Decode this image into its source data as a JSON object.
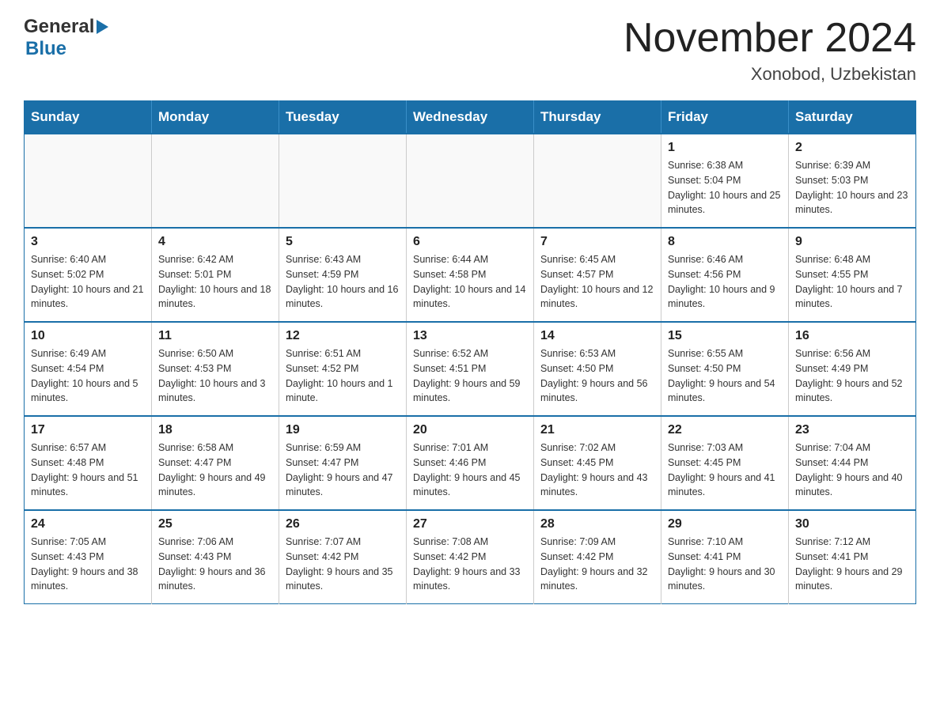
{
  "header": {
    "month_year": "November 2024",
    "location": "Xonobod, Uzbekistan",
    "logo_general": "General",
    "logo_blue": "Blue"
  },
  "days_of_week": [
    "Sunday",
    "Monday",
    "Tuesday",
    "Wednesday",
    "Thursday",
    "Friday",
    "Saturday"
  ],
  "weeks": [
    [
      {
        "day": "",
        "info": ""
      },
      {
        "day": "",
        "info": ""
      },
      {
        "day": "",
        "info": ""
      },
      {
        "day": "",
        "info": ""
      },
      {
        "day": "",
        "info": ""
      },
      {
        "day": "1",
        "info": "Sunrise: 6:38 AM\nSunset: 5:04 PM\nDaylight: 10 hours and 25 minutes."
      },
      {
        "day": "2",
        "info": "Sunrise: 6:39 AM\nSunset: 5:03 PM\nDaylight: 10 hours and 23 minutes."
      }
    ],
    [
      {
        "day": "3",
        "info": "Sunrise: 6:40 AM\nSunset: 5:02 PM\nDaylight: 10 hours and 21 minutes."
      },
      {
        "day": "4",
        "info": "Sunrise: 6:42 AM\nSunset: 5:01 PM\nDaylight: 10 hours and 18 minutes."
      },
      {
        "day": "5",
        "info": "Sunrise: 6:43 AM\nSunset: 4:59 PM\nDaylight: 10 hours and 16 minutes."
      },
      {
        "day": "6",
        "info": "Sunrise: 6:44 AM\nSunset: 4:58 PM\nDaylight: 10 hours and 14 minutes."
      },
      {
        "day": "7",
        "info": "Sunrise: 6:45 AM\nSunset: 4:57 PM\nDaylight: 10 hours and 12 minutes."
      },
      {
        "day": "8",
        "info": "Sunrise: 6:46 AM\nSunset: 4:56 PM\nDaylight: 10 hours and 9 minutes."
      },
      {
        "day": "9",
        "info": "Sunrise: 6:48 AM\nSunset: 4:55 PM\nDaylight: 10 hours and 7 minutes."
      }
    ],
    [
      {
        "day": "10",
        "info": "Sunrise: 6:49 AM\nSunset: 4:54 PM\nDaylight: 10 hours and 5 minutes."
      },
      {
        "day": "11",
        "info": "Sunrise: 6:50 AM\nSunset: 4:53 PM\nDaylight: 10 hours and 3 minutes."
      },
      {
        "day": "12",
        "info": "Sunrise: 6:51 AM\nSunset: 4:52 PM\nDaylight: 10 hours and 1 minute."
      },
      {
        "day": "13",
        "info": "Sunrise: 6:52 AM\nSunset: 4:51 PM\nDaylight: 9 hours and 59 minutes."
      },
      {
        "day": "14",
        "info": "Sunrise: 6:53 AM\nSunset: 4:50 PM\nDaylight: 9 hours and 56 minutes."
      },
      {
        "day": "15",
        "info": "Sunrise: 6:55 AM\nSunset: 4:50 PM\nDaylight: 9 hours and 54 minutes."
      },
      {
        "day": "16",
        "info": "Sunrise: 6:56 AM\nSunset: 4:49 PM\nDaylight: 9 hours and 52 minutes."
      }
    ],
    [
      {
        "day": "17",
        "info": "Sunrise: 6:57 AM\nSunset: 4:48 PM\nDaylight: 9 hours and 51 minutes."
      },
      {
        "day": "18",
        "info": "Sunrise: 6:58 AM\nSunset: 4:47 PM\nDaylight: 9 hours and 49 minutes."
      },
      {
        "day": "19",
        "info": "Sunrise: 6:59 AM\nSunset: 4:47 PM\nDaylight: 9 hours and 47 minutes."
      },
      {
        "day": "20",
        "info": "Sunrise: 7:01 AM\nSunset: 4:46 PM\nDaylight: 9 hours and 45 minutes."
      },
      {
        "day": "21",
        "info": "Sunrise: 7:02 AM\nSunset: 4:45 PM\nDaylight: 9 hours and 43 minutes."
      },
      {
        "day": "22",
        "info": "Sunrise: 7:03 AM\nSunset: 4:45 PM\nDaylight: 9 hours and 41 minutes."
      },
      {
        "day": "23",
        "info": "Sunrise: 7:04 AM\nSunset: 4:44 PM\nDaylight: 9 hours and 40 minutes."
      }
    ],
    [
      {
        "day": "24",
        "info": "Sunrise: 7:05 AM\nSunset: 4:43 PM\nDaylight: 9 hours and 38 minutes."
      },
      {
        "day": "25",
        "info": "Sunrise: 7:06 AM\nSunset: 4:43 PM\nDaylight: 9 hours and 36 minutes."
      },
      {
        "day": "26",
        "info": "Sunrise: 7:07 AM\nSunset: 4:42 PM\nDaylight: 9 hours and 35 minutes."
      },
      {
        "day": "27",
        "info": "Sunrise: 7:08 AM\nSunset: 4:42 PM\nDaylight: 9 hours and 33 minutes."
      },
      {
        "day": "28",
        "info": "Sunrise: 7:09 AM\nSunset: 4:42 PM\nDaylight: 9 hours and 32 minutes."
      },
      {
        "day": "29",
        "info": "Sunrise: 7:10 AM\nSunset: 4:41 PM\nDaylight: 9 hours and 30 minutes."
      },
      {
        "day": "30",
        "info": "Sunrise: 7:12 AM\nSunset: 4:41 PM\nDaylight: 9 hours and 29 minutes."
      }
    ]
  ]
}
